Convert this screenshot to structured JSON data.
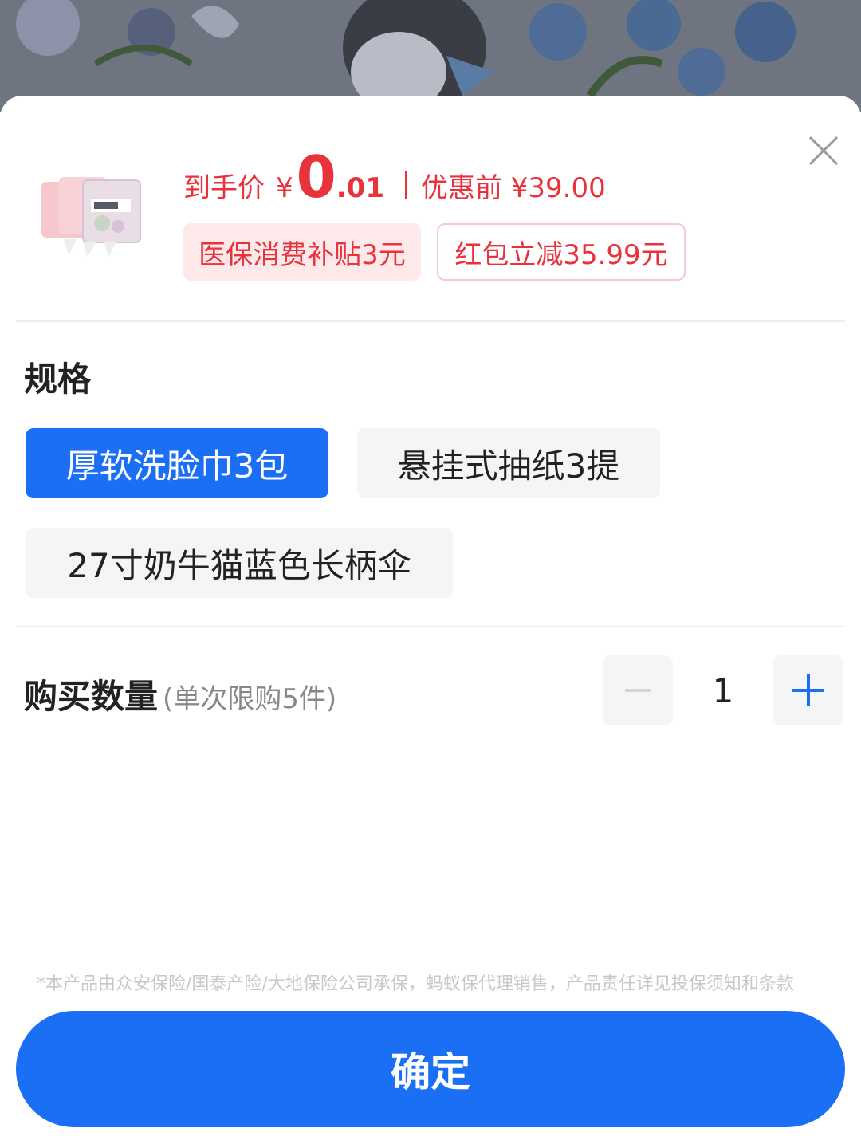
{
  "product": {
    "price_label": "到手价",
    "currency": "¥",
    "price_integer": "0",
    "price_decimal": ".01",
    "before_label": "优惠前 ¥39.00"
  },
  "discount_tags": [
    {
      "label": "医保消费补贴3元"
    },
    {
      "label": "红包立减35.99元"
    }
  ],
  "spec_section": {
    "title": "规格",
    "options": [
      {
        "label": "厚软洗脸巾3包",
        "selected": true
      },
      {
        "label": "悬挂式抽纸3提",
        "selected": false
      },
      {
        "label": "27寸奶牛猫蓝色长柄伞",
        "selected": false
      }
    ]
  },
  "quantity": {
    "label": "购买数量",
    "note": "(单次限购5件)",
    "value": "1"
  },
  "disclaimer": "*本产品由众安保险/国泰产险/大地保险公司承保，蚂蚁保代理销售，产品责任详见投保须知和条款",
  "confirm_label": "确定",
  "colors": {
    "accent": "#1a6ff5",
    "price_red": "#e8323c",
    "tag_bg": "#fde8ea"
  }
}
